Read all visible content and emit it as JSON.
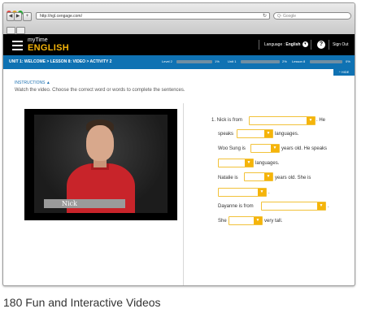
{
  "browser": {
    "url": "http://ngl.cengage.com/",
    "search_placeholder": "Q- Google",
    "refresh_icon": "refresh-icon",
    "back_label": "◀",
    "forward_label": "▶",
    "add_label": "+",
    "traffic_colors": [
      "#e0443e",
      "#dea123",
      "#1aab29"
    ]
  },
  "header": {
    "brand_top": "myTime",
    "brand_bottom": "ENGLISH",
    "language_label": "Language :",
    "language_value": "English",
    "help_label": "?",
    "signout_label": "Sign Out"
  },
  "activity": {
    "breadcrumb": "UNIT 1: WELCOME  >  LESSON 8: VIDEO  >  ACTIVITY 2",
    "progress": [
      {
        "label": "Level 2",
        "value": "1%"
      },
      {
        "label": "Unit 1",
        "value": "2%"
      },
      {
        "label": "Lesson 8",
        "value": "0%"
      }
    ],
    "hide_label": "^ HIDE"
  },
  "content": {
    "instructions_title": "INSTRUCTIONS ▲",
    "instructions_text": "Watch the video. Choose the correct word or words to complete the sentences."
  },
  "video": {
    "name_tag": "Nick"
  },
  "exercise": {
    "t1": "1. Nick is from",
    "t1b": ". He",
    "t2": "speaks",
    "t2b": "languages.",
    "t3": "Woo Sung is",
    "t3b": "years old. He speaks",
    "t4b": "languages.",
    "t5": "Natalie is",
    "t5b": "years old. She is",
    "t6b": ".",
    "t7": "Dayanne is from",
    "t7b": ".",
    "t8": "She",
    "t8b": "very tall.",
    "dropdown_arrow": "▼"
  },
  "caption": "180 Fun and Interactive Videos",
  "colors": {
    "header_bg": "#000000",
    "brand_accent": "#f5b40a",
    "activity_bar": "#0f72b3",
    "dropdown_accent": "#f5b40a"
  }
}
